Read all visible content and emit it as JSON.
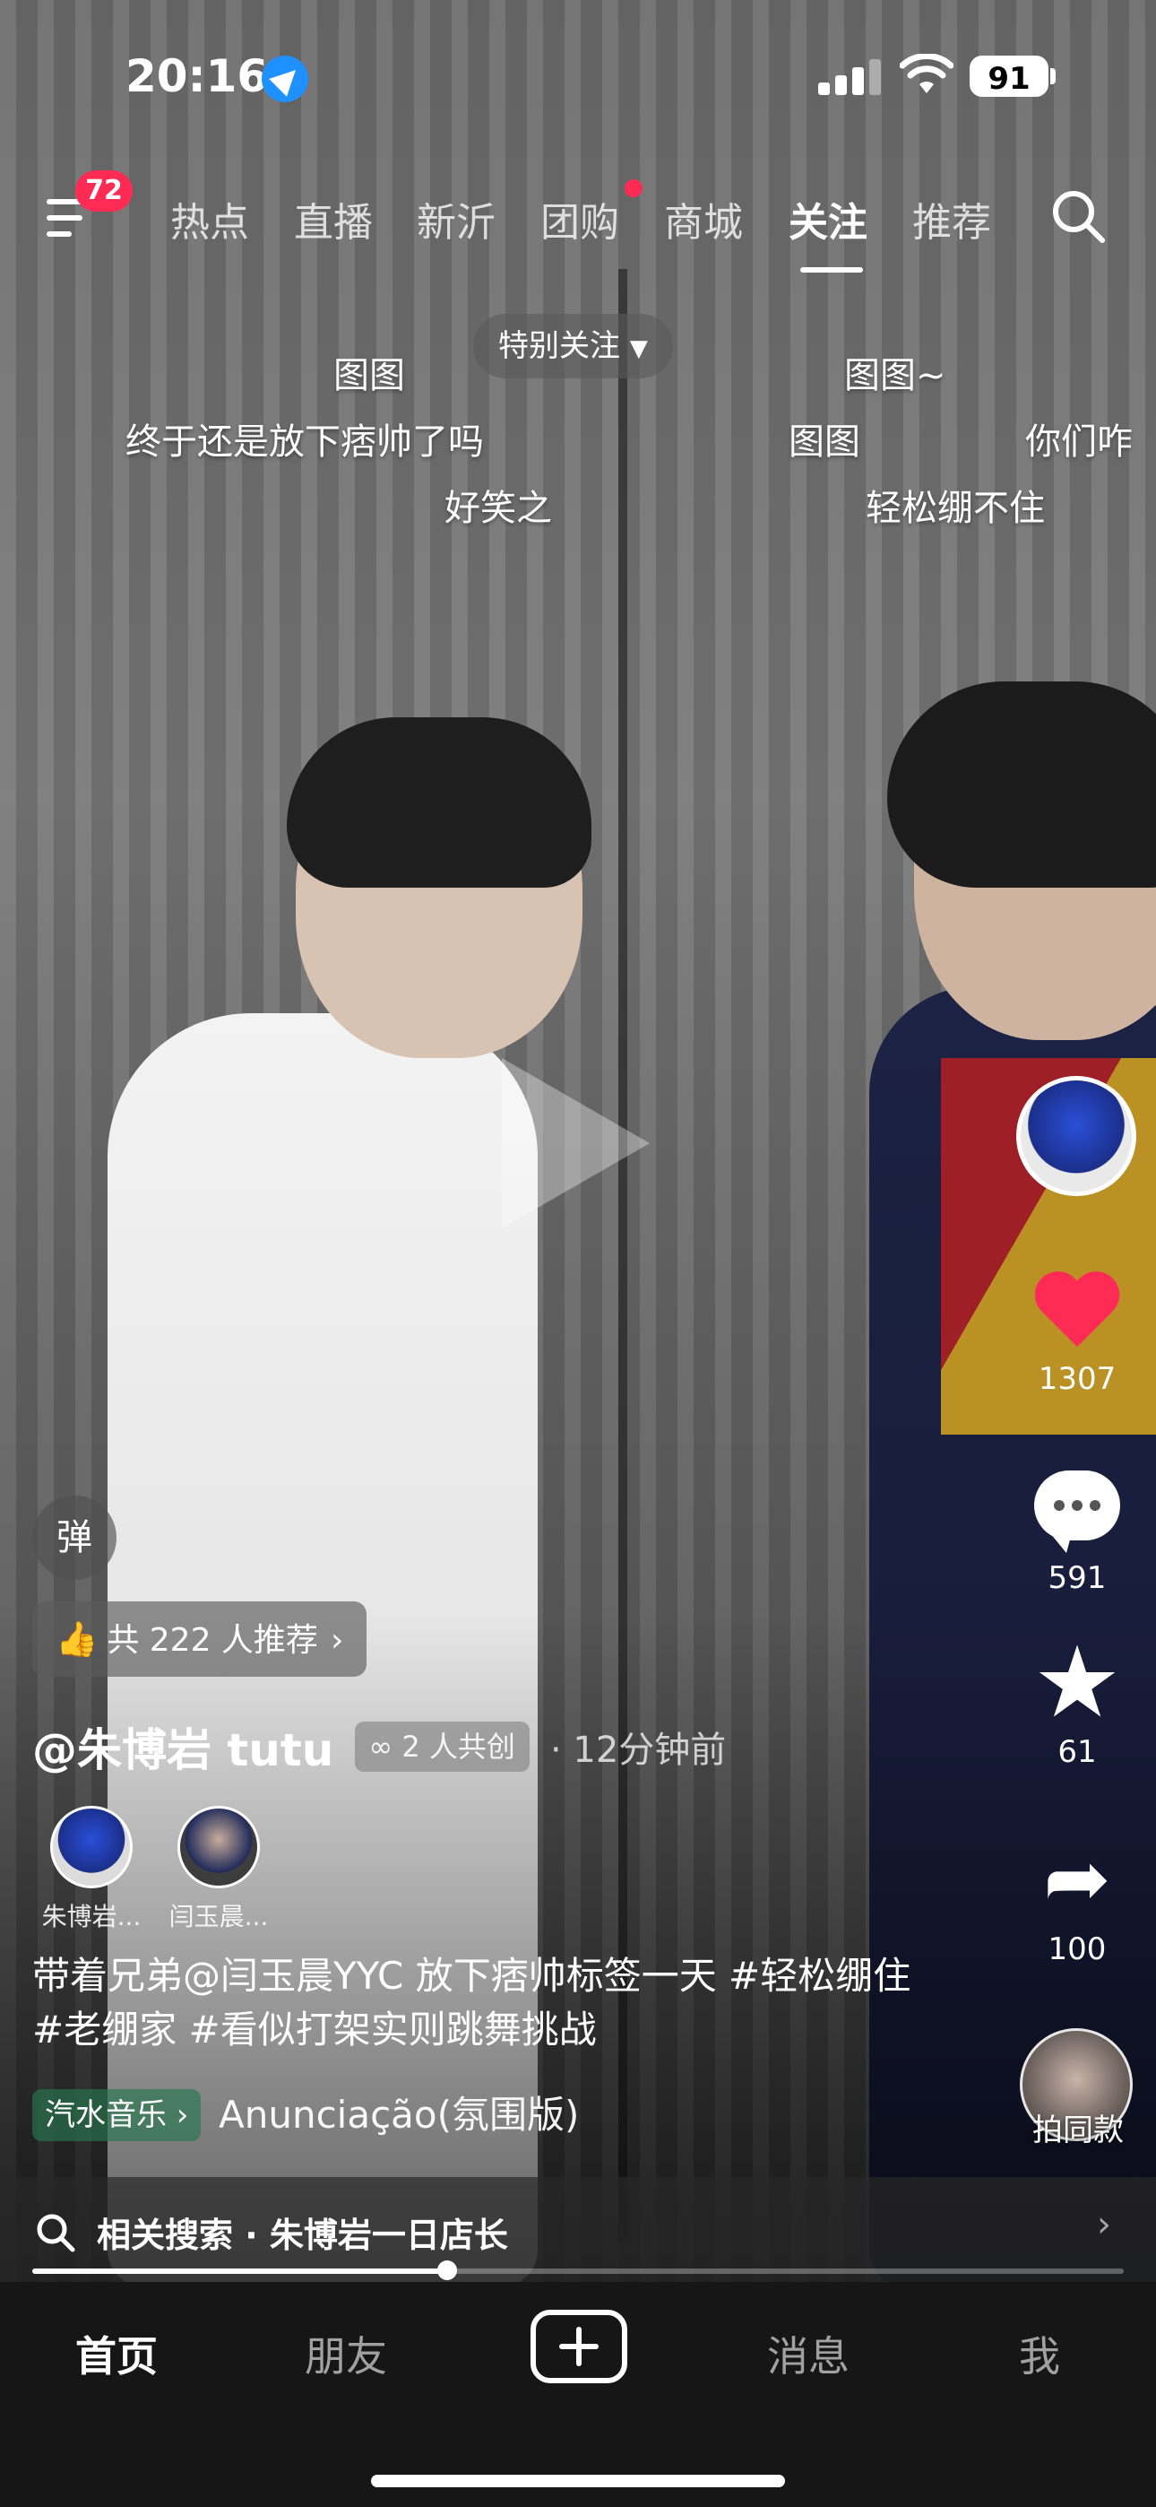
{
  "status_bar": {
    "time": "20:16",
    "battery": "91"
  },
  "top_nav": {
    "menu_badge": "72",
    "tabs": [
      {
        "label": "热点"
      },
      {
        "label": "直播"
      },
      {
        "label": "新沂"
      },
      {
        "label": "团购"
      },
      {
        "label": "商城"
      },
      {
        "label": "关注"
      },
      {
        "label": "推荐"
      }
    ],
    "active_tab": "关注"
  },
  "overlay": {
    "special_follow": "特别关注",
    "danmaku": [
      "图图",
      "终于还是放下痞帅了吗",
      "好笑之",
      "图图~",
      "图图",
      "轻松绷不住",
      "你们咋"
    ]
  },
  "actions": {
    "likes": "1307",
    "comments": "591",
    "favorites": "61",
    "shares": "100",
    "same_style": "拍同款"
  },
  "info": {
    "danmaku_button": "弹",
    "recommend": "共 222 人推荐",
    "author": "@朱博岩 tutu",
    "cocreate": "2 人共创",
    "ago": "12分钟前",
    "co_creators": [
      {
        "name": "朱博岩..."
      },
      {
        "name": "闫玉晨..."
      }
    ],
    "description": "带着兄弟@闫玉晨YYC 放下痞帅标签一天 #轻松绷住 #老绷家 #看似打架实则跳舞挑战",
    "music_tag": "汽水音乐",
    "music_title": "Anunciação(氛围版)"
  },
  "related_search": {
    "text": "相关搜索 · 朱博岩一日店长"
  },
  "progress": {
    "value": 0.38
  },
  "bottom_tabs": {
    "home": "首页",
    "friends": "朋友",
    "messages": "消息",
    "me": "我"
  }
}
